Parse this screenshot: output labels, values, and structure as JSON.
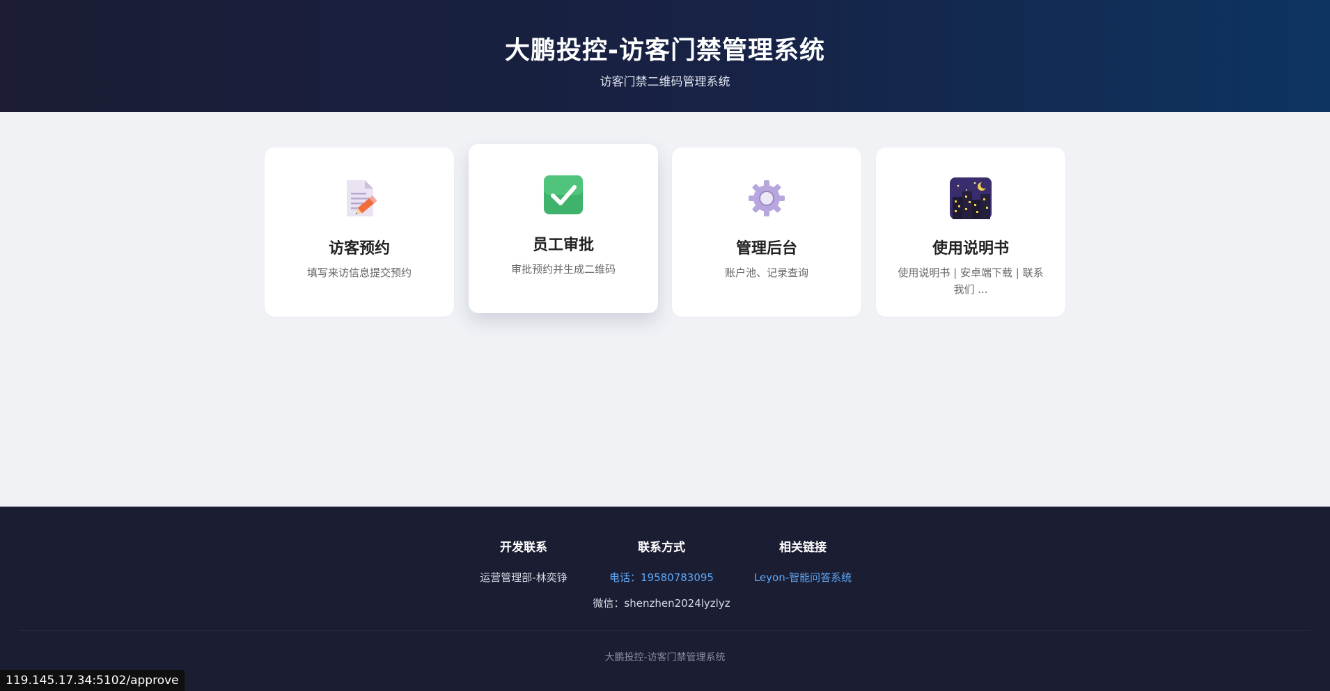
{
  "header": {
    "title": "大鹏投控-访客门禁管理系统",
    "subtitle": "访客门禁二维码管理系统"
  },
  "cards": [
    {
      "icon": "memo-pencil-icon",
      "title": "访客预约",
      "desc": "填写来访信息提交预约"
    },
    {
      "icon": "check-mark-icon",
      "title": "员工审批",
      "desc": "审批预约并生成二维码"
    },
    {
      "icon": "gear-icon",
      "title": "管理后台",
      "desc": "账户池、记录查询"
    },
    {
      "icon": "night-city-icon",
      "title": "使用说明书",
      "desc": "使用说明书 | 安卓端下载 | 联系我们 ..."
    }
  ],
  "footer": {
    "dev": {
      "heading": "开发联系",
      "line1": "运营管理部-林奕铮"
    },
    "contact": {
      "heading": "联系方式",
      "phone": "电话：19580783095",
      "wechat": "微信：shenzhen2024lyzlyz"
    },
    "links": {
      "heading": "相关链接",
      "link1": "Leyon-智能问答系统"
    },
    "copyright": "大鹏投控-访客门禁管理系统"
  },
  "status_bar": {
    "url": "119.145.17.34:5102/approve"
  },
  "colors": {
    "accent_link": "#5ea8f5",
    "header_dark": "#1b1c34",
    "header_blue": "#0d3461",
    "footer_bg": "#1b1d33"
  }
}
